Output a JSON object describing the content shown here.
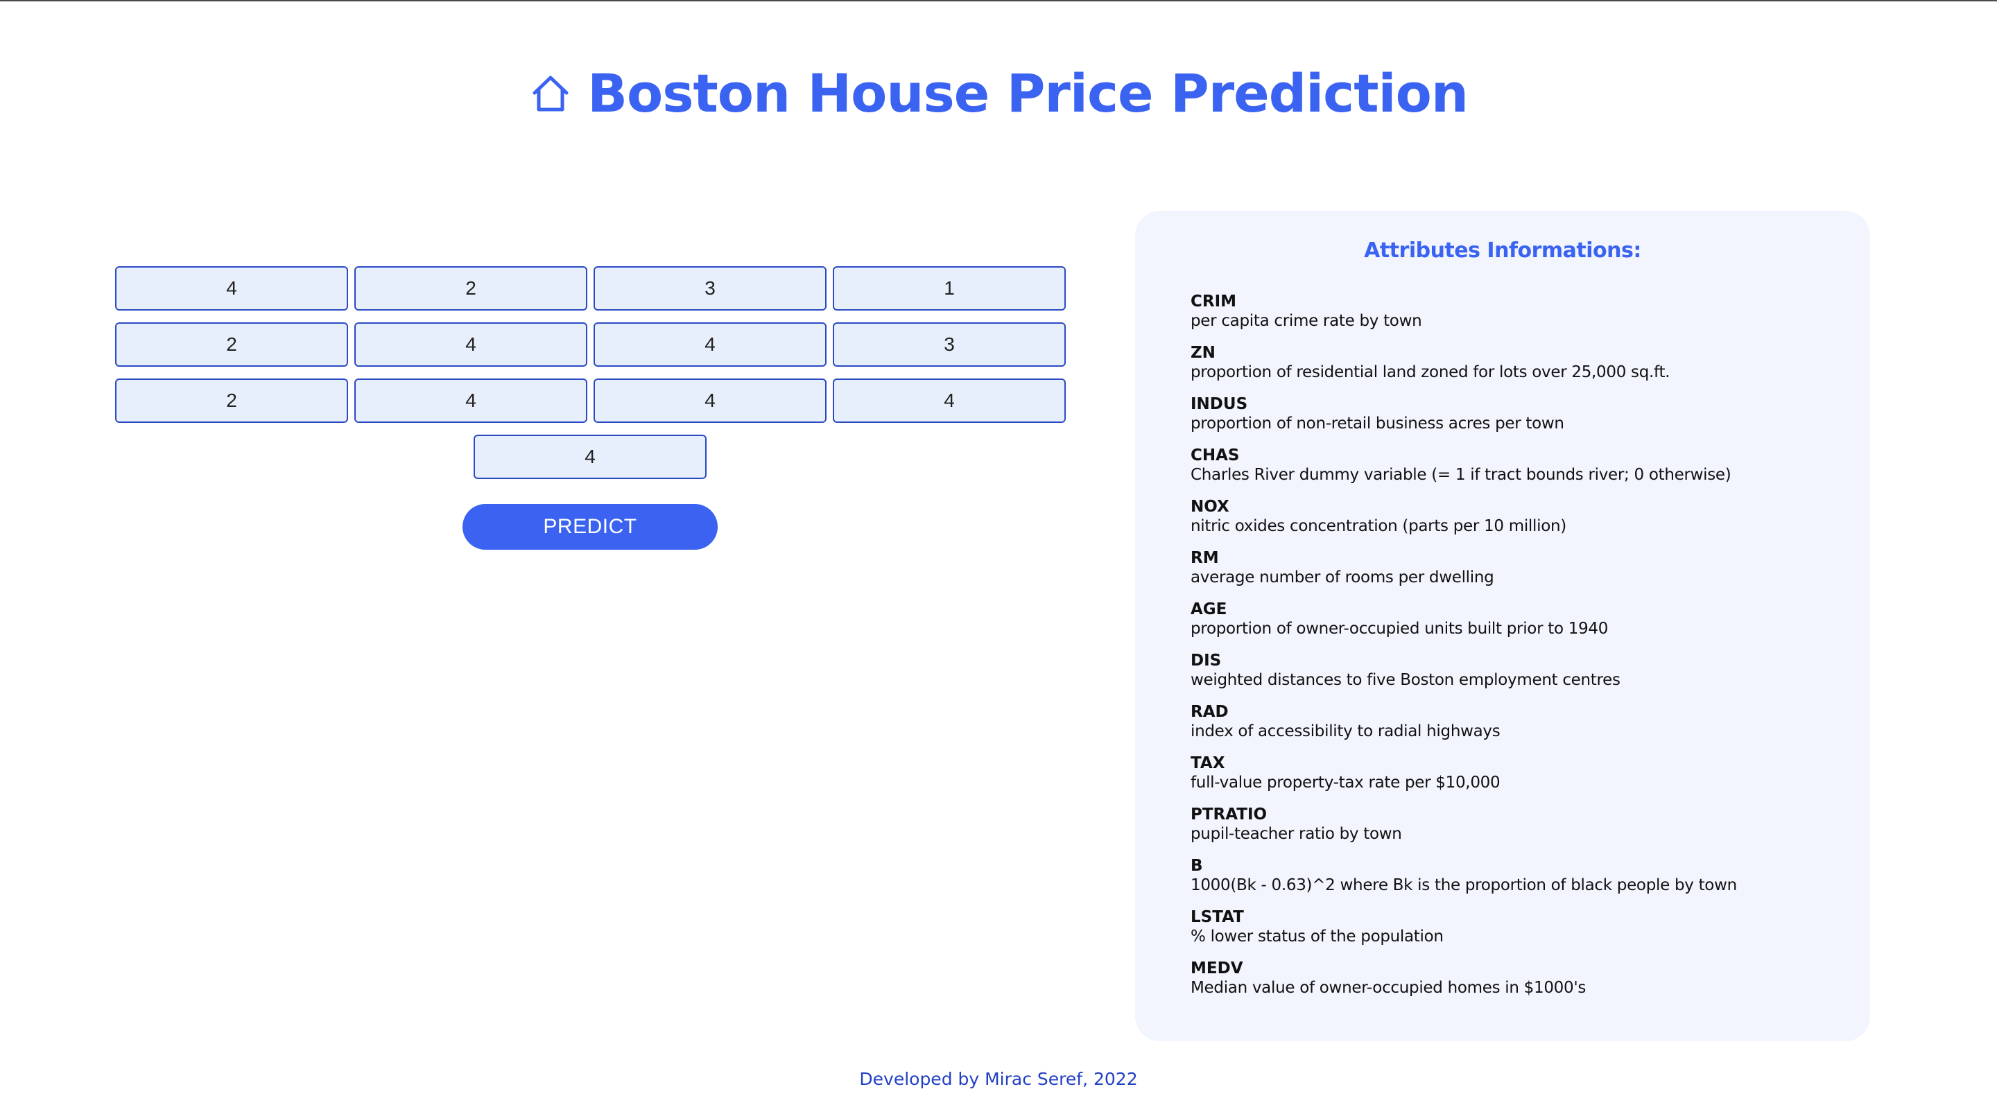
{
  "header": {
    "icon": "home-icon",
    "title": "Boston House Price Prediction"
  },
  "form": {
    "inputs": [
      "4",
      "2",
      "3",
      "1",
      "2",
      "4",
      "4",
      "3",
      "2",
      "4",
      "4",
      "4",
      "4"
    ],
    "predict_label": "PREDICT"
  },
  "info": {
    "title": "Attributes Informations:",
    "attributes": [
      {
        "name": "CRIM",
        "desc": "per capita crime rate by town"
      },
      {
        "name": "ZN",
        "desc": "proportion of residential land zoned for lots over 25,000 sq.ft."
      },
      {
        "name": "INDUS",
        "desc": "proportion of non-retail business acres per town"
      },
      {
        "name": "CHAS",
        "desc": "Charles River dummy variable (= 1 if tract bounds river; 0 otherwise)"
      },
      {
        "name": "NOX",
        "desc": "nitric oxides concentration (parts per 10 million)"
      },
      {
        "name": "RM",
        "desc": "average number of rooms per dwelling"
      },
      {
        "name": "AGE",
        "desc": "proportion of owner-occupied units built prior to 1940"
      },
      {
        "name": "DIS",
        "desc": "weighted distances to five Boston employment centres"
      },
      {
        "name": "RAD",
        "desc": "index of accessibility to radial highways"
      },
      {
        "name": "TAX",
        "desc": "full-value property-tax rate per $10,000"
      },
      {
        "name": "PTRATIO",
        "desc": "pupil-teacher ratio by town"
      },
      {
        "name": "B",
        "desc": "1000(Bk - 0.63)^2 where Bk is the proportion of black people by town"
      },
      {
        "name": "LSTAT",
        "desc": "% lower status of the population"
      },
      {
        "name": "MEDV",
        "desc": "Median value of owner-occupied homes in $1000's"
      }
    ]
  },
  "footer": {
    "text": "Developed by Mirac Seref, 2022"
  },
  "colors": {
    "accent": "#3a63f2",
    "input_bg": "#e8effc",
    "input_border": "#2b4bc4",
    "panel_bg": "#f2f5fd",
    "footer_text": "#2340c4"
  }
}
